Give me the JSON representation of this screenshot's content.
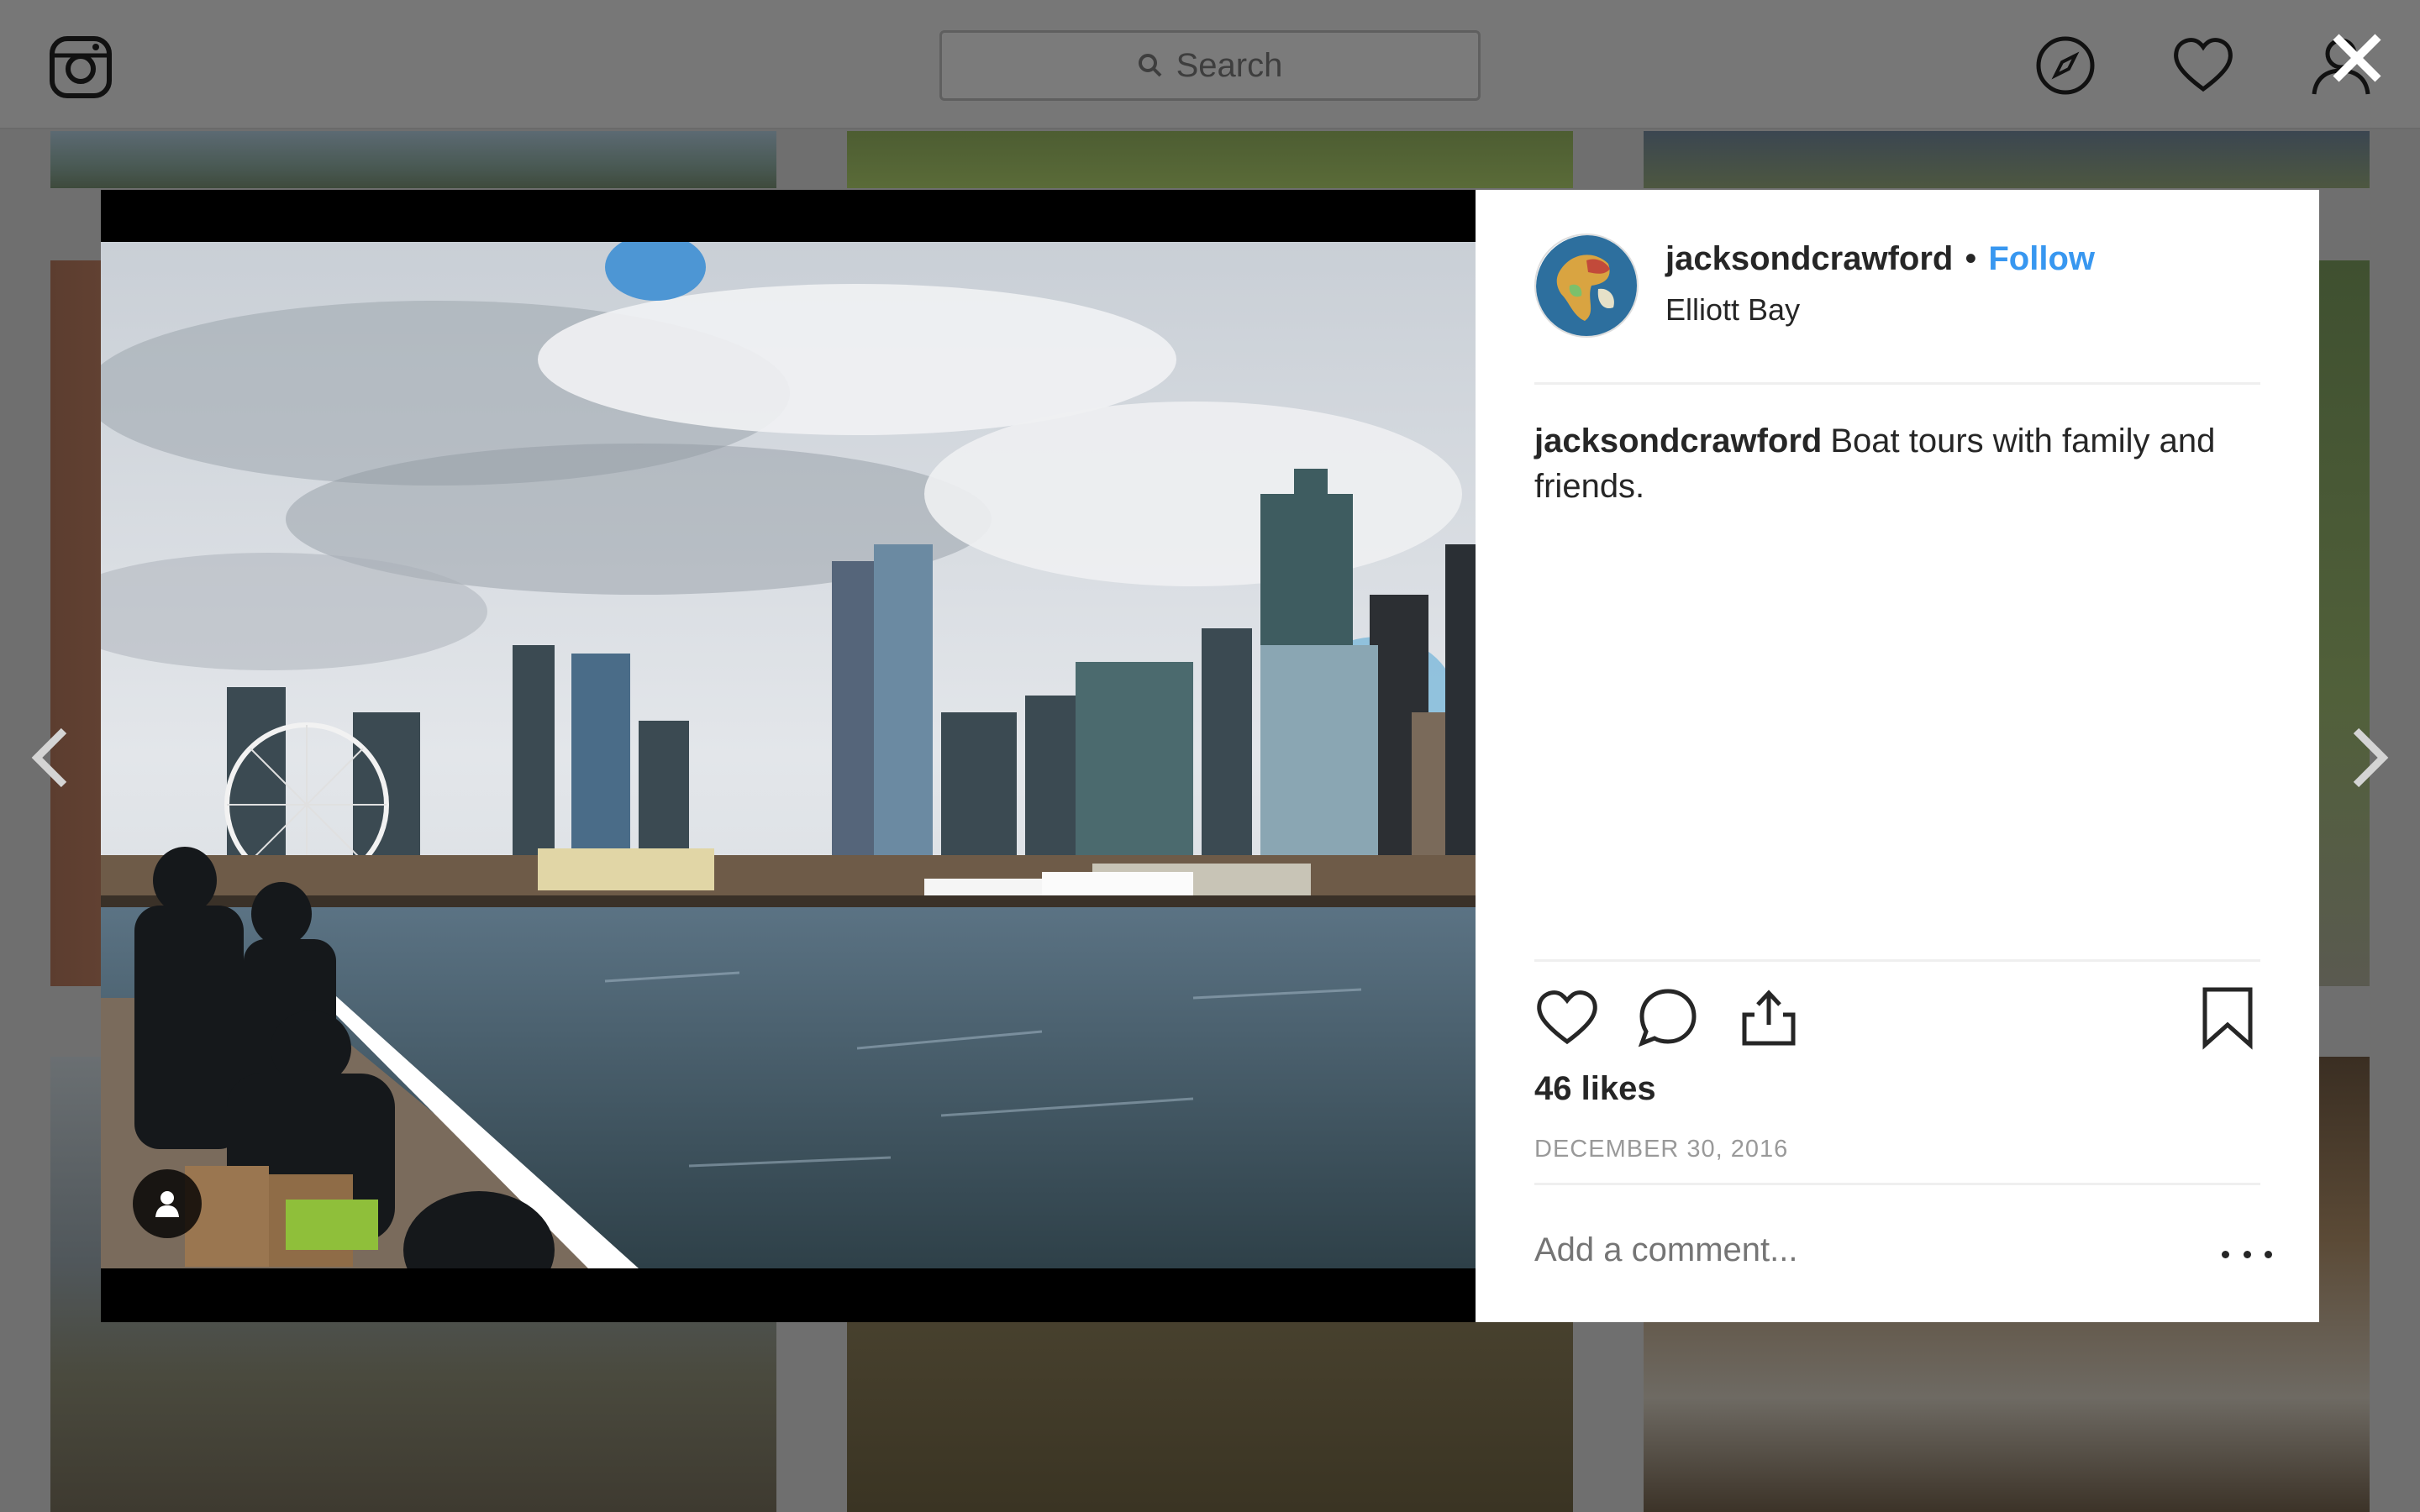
{
  "topbar": {
    "logo_icon": "instagram-icon",
    "search_placeholder": "Search",
    "nav_icons": [
      "compass-icon",
      "heart-icon",
      "profile-icon"
    ]
  },
  "overlay": {
    "close_icon": "close-icon",
    "prev_icon": "chevron-left-icon",
    "next_icon": "chevron-right-icon"
  },
  "post": {
    "username": "jacksondcrawford",
    "separator": "•",
    "follow_label": "Follow",
    "location": "Elliott Bay",
    "caption_user": "jacksondcrawford",
    "caption_text": "Boat tours with family and friends.",
    "likes": "46 likes",
    "date": "DECEMBER 30, 2016",
    "comment_placeholder": "Add a comment...",
    "action_icons": [
      "heart-icon",
      "comment-icon",
      "share-icon",
      "bookmark-icon"
    ],
    "more_icon": "more-options-icon"
  },
  "colors": {
    "accent": "#3897f0",
    "text": "#262626",
    "muted": "#999999",
    "backdrop": "#6f6f6f"
  }
}
